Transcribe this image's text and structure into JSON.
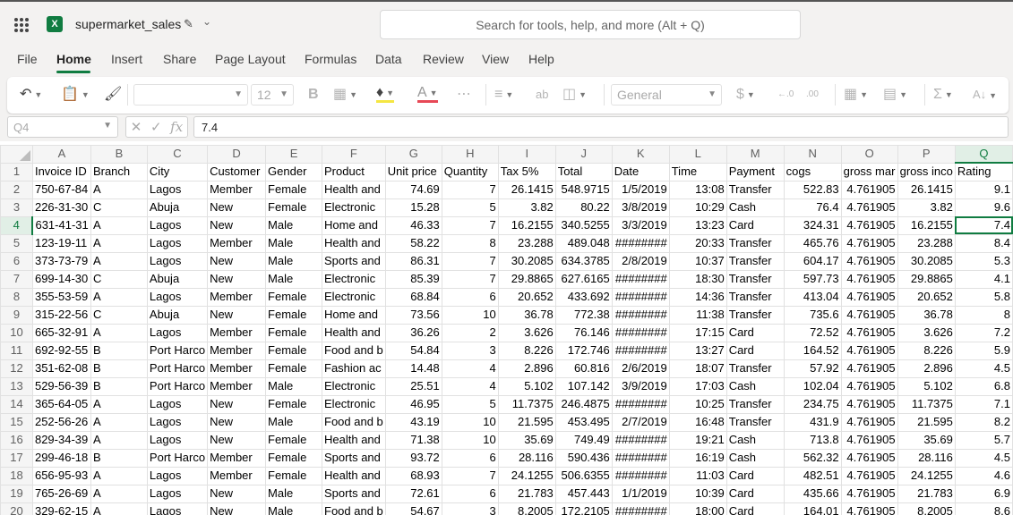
{
  "app": {
    "doc_title": "supermarket_sales",
    "search_placeholder": "Search for tools, help, and more (Alt + Q)",
    "accent": "#107c41"
  },
  "menu": [
    "File",
    "Home",
    "Insert",
    "Share",
    "Page Layout",
    "Formulas",
    "Data",
    "Review",
    "View",
    "Help"
  ],
  "ribbon": {
    "font_size": "12",
    "number_format": "General",
    "icons": [
      "undo-icon",
      "paste-icon",
      "format-painter-icon",
      "bold-icon",
      "borders-icon",
      "fill-color-icon",
      "font-color-icon",
      "more-icon",
      "align-icon",
      "wrap-text-icon",
      "merge-icon",
      "currency-icon",
      "increase-decimal-icon",
      "decrease-decimal-icon",
      "conditional-format-icon",
      "format-as-table-icon",
      "autosum-icon",
      "sort-filter-icon"
    ]
  },
  "formula_bar": {
    "name_box": "Q4",
    "formula": "7.4"
  },
  "sheet": {
    "columns": [
      "A",
      "B",
      "C",
      "D",
      "E",
      "F",
      "G",
      "H",
      "I",
      "J",
      "K",
      "L",
      "M",
      "N",
      "O",
      "P",
      "Q"
    ],
    "selected_column": "Q",
    "selected_row": 4,
    "header": [
      "Invoice ID",
      "Branch",
      "City",
      "Customer",
      "Gender",
      "Product",
      "Unit price",
      "Quantity",
      "Tax 5%",
      "Total",
      "Date",
      "Time",
      "Payment",
      "cogs",
      "gross mar",
      "gross inco",
      "Rating"
    ],
    "rows": [
      [
        "750-67-84",
        "A",
        "Lagos",
        "Member",
        "Female",
        "Health and",
        "74.69",
        "7",
        "26.1415",
        "548.9715",
        "1/5/2019",
        "13:08",
        "Transfer",
        "522.83",
        "4.761905",
        "26.1415",
        "9.1"
      ],
      [
        "226-31-30",
        "C",
        "Abuja",
        "New",
        "Female",
        "Electronic",
        "15.28",
        "5",
        "3.82",
        "80.22",
        "3/8/2019",
        "10:29",
        "Cash",
        "76.4",
        "4.761905",
        "3.82",
        "9.6"
      ],
      [
        "631-41-31",
        "A",
        "Lagos",
        "New",
        "Male",
        "Home and",
        "46.33",
        "7",
        "16.2155",
        "340.5255",
        "3/3/2019",
        "13:23",
        "Card",
        "324.31",
        "4.761905",
        "16.2155",
        "7.4"
      ],
      [
        "123-19-11",
        "A",
        "Lagos",
        "Member",
        "Male",
        "Health and",
        "58.22",
        "8",
        "23.288",
        "489.048",
        "########",
        "20:33",
        "Transfer",
        "465.76",
        "4.761905",
        "23.288",
        "8.4"
      ],
      [
        "373-73-79",
        "A",
        "Lagos",
        "New",
        "Male",
        "Sports and",
        "86.31",
        "7",
        "30.2085",
        "634.3785",
        "2/8/2019",
        "10:37",
        "Transfer",
        "604.17",
        "4.761905",
        "30.2085",
        "5.3"
      ],
      [
        "699-14-30",
        "C",
        "Abuja",
        "New",
        "Male",
        "Electronic",
        "85.39",
        "7",
        "29.8865",
        "627.6165",
        "########",
        "18:30",
        "Transfer",
        "597.73",
        "4.761905",
        "29.8865",
        "4.1"
      ],
      [
        "355-53-59",
        "A",
        "Lagos",
        "Member",
        "Female",
        "Electronic",
        "68.84",
        "6",
        "20.652",
        "433.692",
        "########",
        "14:36",
        "Transfer",
        "413.04",
        "4.761905",
        "20.652",
        "5.8"
      ],
      [
        "315-22-56",
        "C",
        "Abuja",
        "New",
        "Female",
        "Home and",
        "73.56",
        "10",
        "36.78",
        "772.38",
        "########",
        "11:38",
        "Transfer",
        "735.6",
        "4.761905",
        "36.78",
        "8"
      ],
      [
        "665-32-91",
        "A",
        "Lagos",
        "Member",
        "Female",
        "Health and",
        "36.26",
        "2",
        "3.626",
        "76.146",
        "########",
        "17:15",
        "Card",
        "72.52",
        "4.761905",
        "3.626",
        "7.2"
      ],
      [
        "692-92-55",
        "B",
        "Port Harco",
        "Member",
        "Female",
        "Food and b",
        "54.84",
        "3",
        "8.226",
        "172.746",
        "########",
        "13:27",
        "Card",
        "164.52",
        "4.761905",
        "8.226",
        "5.9"
      ],
      [
        "351-62-08",
        "B",
        "Port Harco",
        "Member",
        "Female",
        "Fashion ac",
        "14.48",
        "4",
        "2.896",
        "60.816",
        "2/6/2019",
        "18:07",
        "Transfer",
        "57.92",
        "4.761905",
        "2.896",
        "4.5"
      ],
      [
        "529-56-39",
        "B",
        "Port Harco",
        "Member",
        "Male",
        "Electronic",
        "25.51",
        "4",
        "5.102",
        "107.142",
        "3/9/2019",
        "17:03",
        "Cash",
        "102.04",
        "4.761905",
        "5.102",
        "6.8"
      ],
      [
        "365-64-05",
        "A",
        "Lagos",
        "New",
        "Female",
        "Electronic",
        "46.95",
        "5",
        "11.7375",
        "246.4875",
        "########",
        "10:25",
        "Transfer",
        "234.75",
        "4.761905",
        "11.7375",
        "7.1"
      ],
      [
        "252-56-26",
        "A",
        "Lagos",
        "New",
        "Male",
        "Food and b",
        "43.19",
        "10",
        "21.595",
        "453.495",
        "2/7/2019",
        "16:48",
        "Transfer",
        "431.9",
        "4.761905",
        "21.595",
        "8.2"
      ],
      [
        "829-34-39",
        "A",
        "Lagos",
        "New",
        "Female",
        "Health and",
        "71.38",
        "10",
        "35.69",
        "749.49",
        "########",
        "19:21",
        "Cash",
        "713.8",
        "4.761905",
        "35.69",
        "5.7"
      ],
      [
        "299-46-18",
        "B",
        "Port Harco",
        "Member",
        "Female",
        "Sports and",
        "93.72",
        "6",
        "28.116",
        "590.436",
        "########",
        "16:19",
        "Cash",
        "562.32",
        "4.761905",
        "28.116",
        "4.5"
      ],
      [
        "656-95-93",
        "A",
        "Lagos",
        "Member",
        "Female",
        "Health and",
        "68.93",
        "7",
        "24.1255",
        "506.6355",
        "########",
        "11:03",
        "Card",
        "482.51",
        "4.761905",
        "24.1255",
        "4.6"
      ],
      [
        "765-26-69",
        "A",
        "Lagos",
        "New",
        "Male",
        "Sports and",
        "72.61",
        "6",
        "21.783",
        "457.443",
        "1/1/2019",
        "10:39",
        "Card",
        "435.66",
        "4.761905",
        "21.783",
        "6.9"
      ],
      [
        "329-62-15",
        "A",
        "Lagos",
        "New",
        "Male",
        "Food and b",
        "54.67",
        "3",
        "8.2005",
        "172.2105",
        "########",
        "18:00",
        "Card",
        "164.01",
        "4.761905",
        "8.2005",
        "8.6"
      ]
    ]
  }
}
